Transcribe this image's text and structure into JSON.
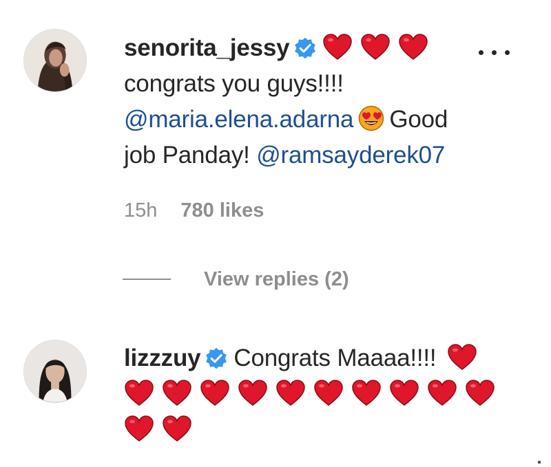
{
  "comments": [
    {
      "username": "senorita_jessy",
      "verified": true,
      "hearts_after_name": 3,
      "text_line1": "congrats you guys!!!!",
      "mention1": "@maria.elena.adarna",
      "emoji1": "heart-eyes-emoji",
      "text_good": "Good",
      "text_job": "job Panday!",
      "mention2": "@ramsayderek07",
      "time": "15h",
      "likes": "780 likes",
      "view_replies": "View replies (2)"
    },
    {
      "username": "lizzzuy",
      "verified": true,
      "text": "Congrats Maaaa!!!!",
      "hearts_total": 13
    }
  ],
  "colors": {
    "text": "#262626",
    "secondary": "#8e8e8e",
    "mention": "#1d4f91",
    "verified_badge": "#3897f0",
    "heart": "#e0162b"
  },
  "icons": [
    "verified-badge-icon",
    "red-heart-emoji",
    "heart-eyes-emoji",
    "more-options-icon"
  ]
}
